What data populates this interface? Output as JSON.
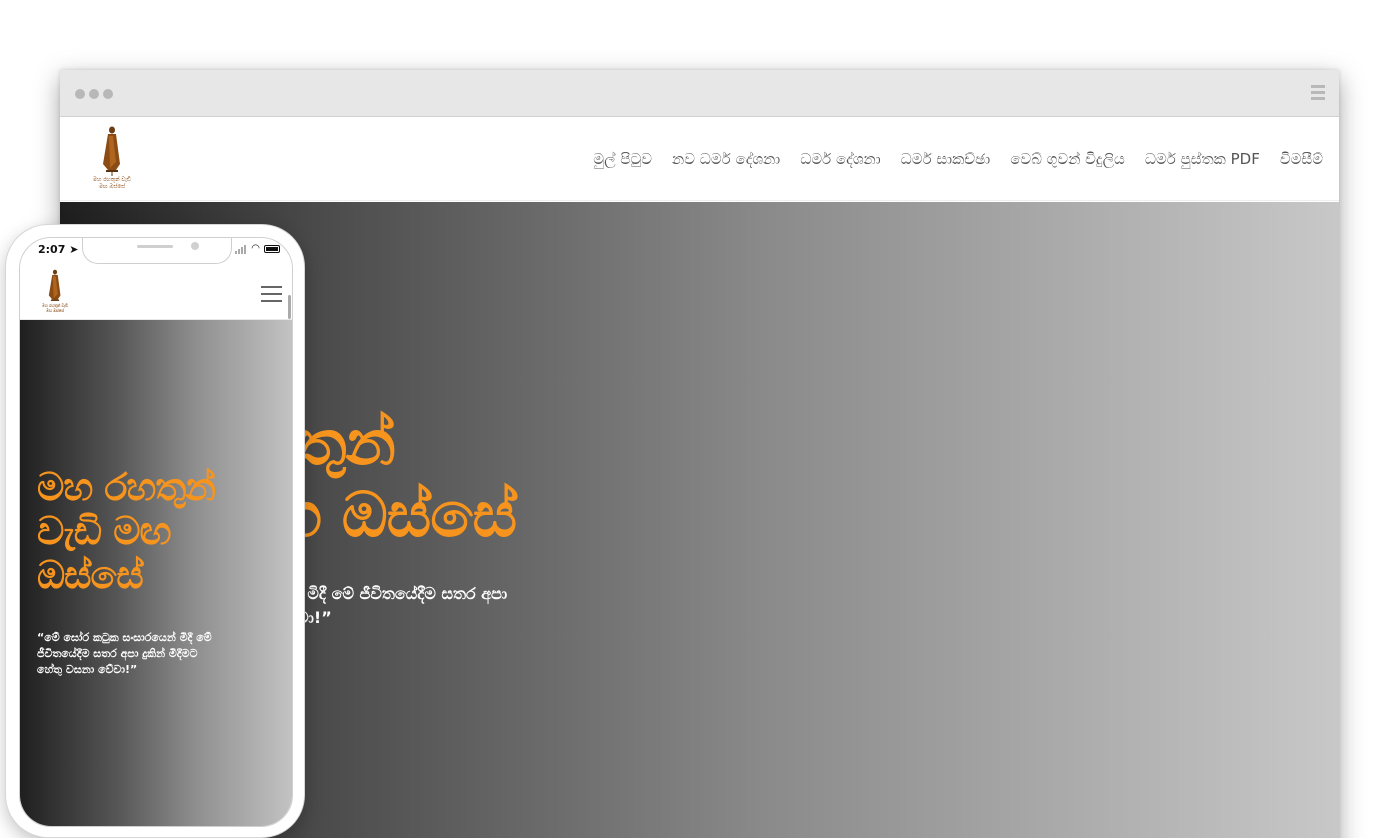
{
  "browser": {
    "menu_icon": "hamburger-icon"
  },
  "desktop": {
    "nav": [
      {
        "label": "මුල් පිටුව"
      },
      {
        "label": "නව ධර්ම දේශනා"
      },
      {
        "label": "ධර්ම දේශනා"
      },
      {
        "label": "ධර්ම සාකච්ඡා"
      },
      {
        "label": "වෙබ් ගුවන් විදුලිය"
      },
      {
        "label": "ධර්ම පුස්තක PDF"
      },
      {
        "label": "විමසීම්"
      }
    ],
    "hero": {
      "title_line1": "මහ රහතුන්",
      "title_line2": "වැඩි මඟ ඔස්සේ",
      "quote": "“මේ ඝෝර කටුක සංසාරයෙන් මිදී මේ ජීවිතයේදීම සතර අපා දුකින් මිදීමට හේතු වසනා වේවා!”"
    }
  },
  "logo": {
    "caption_line1": "මහ රහතුන් වැඩි",
    "caption_line2": "මඟ ඔස්සේ"
  },
  "phone": {
    "status_time": "2:07",
    "menu_icon": "hamburger-icon",
    "hero": {
      "title": "මහ රහතුන් වැඩි මඟ ඔස්සේ",
      "quote": "“මේ ඝෝර කටුක සංසාරයෙන් මිදී මේ ජීවිතයේදීම සතර අපා දුකින් මිදීමට හේතු වසනා වේවා!”"
    }
  },
  "colors": {
    "accent": "#f7941d",
    "nav_text": "#555555",
    "hero_dark": "#1e1e1e",
    "hero_light": "#c8c8c8",
    "browser_bar": "#e7e7e7"
  }
}
